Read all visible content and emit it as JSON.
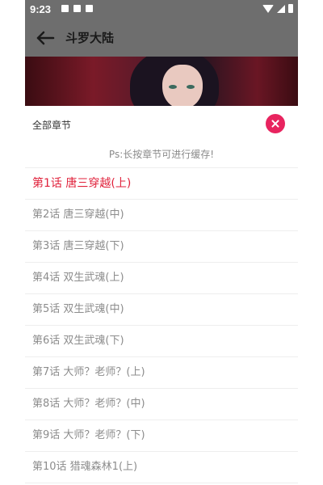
{
  "status_bar": {
    "time": "9:23"
  },
  "toolbar": {
    "title": "斗罗大陆"
  },
  "sheet": {
    "title": "全部章节",
    "hint": "Ps:长按章节可进行缓存!"
  },
  "chapters": [
    {
      "label": "第1话 唐三穿越(上)",
      "active": true
    },
    {
      "label": "第2话 唐三穿越(中)",
      "active": false
    },
    {
      "label": "第3话 唐三穿越(下)",
      "active": false
    },
    {
      "label": "第4话 双生武魂(上)",
      "active": false
    },
    {
      "label": "第5话 双生武魂(中)",
      "active": false
    },
    {
      "label": "第6话 双生武魂(下)",
      "active": false
    },
    {
      "label": "第7话 大师？老师？(上)",
      "active": false
    },
    {
      "label": "第8话 大师？老师？(中)",
      "active": false
    },
    {
      "label": "第9话 大师？老师？(下)",
      "active": false
    },
    {
      "label": "第10话 猎魂森林1(上)",
      "active": false
    }
  ],
  "colors": {
    "accent": "#e0213b",
    "close_button": "#e8245f",
    "overlay": "#6e6e6e"
  },
  "icons": {
    "back": "arrow-left-icon",
    "close": "close-icon"
  }
}
